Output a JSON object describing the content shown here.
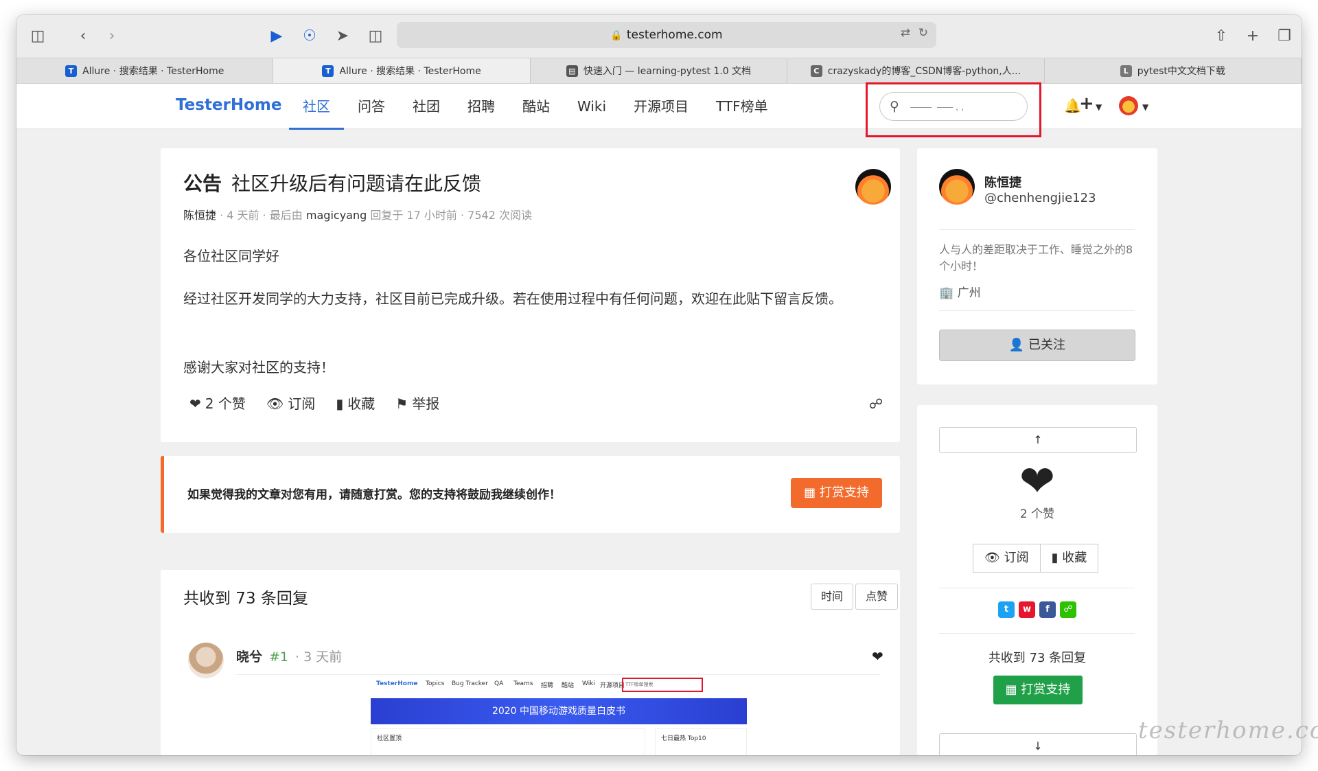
{
  "browser": {
    "url": "testerhome.com",
    "tabs": [
      {
        "title": "Allure · 搜索结果 · TesterHome",
        "icon": "shield-icon"
      },
      {
        "title": "Allure · 搜索结果 · TesterHome",
        "icon": "shield-icon"
      },
      {
        "title": "快速入门 — learning-pytest 1.0 文档",
        "icon": "doc-icon"
      },
      {
        "title": "crazyskady的博客_CSDN博客-python,人...",
        "icon": "c-icon"
      },
      {
        "title": "pytest中文文档下载",
        "icon": "l-icon"
      }
    ]
  },
  "site": {
    "logo": "TesterHome",
    "nav": [
      "社区",
      "问答",
      "社团",
      "招聘",
      "酷站",
      "Wiki",
      "开源项目",
      "TTF榜单"
    ],
    "search_value": "‒‒‒‒  ‒‒‒ , ,"
  },
  "post": {
    "tag": "公告",
    "title": "社区升级后有问题请在此反馈",
    "author": "陈恒捷",
    "time": "· 4 天前 · 最后由",
    "last_replier": "magicyang",
    "reply_info": "回复于 17 小时前 · 7542 次阅读",
    "body": [
      "各位社区同学好",
      "经过社区开发同学的大力支持，社区目前已完成升级。若在使用过程中有任何问题，欢迎在此贴下留言反馈。",
      "感谢大家对社区的支持！"
    ],
    "actions": {
      "likes": "2 个赞",
      "subscribe": "订阅",
      "favorite": "收藏",
      "report": "举报"
    }
  },
  "reward": {
    "text": "如果觉得我的文章对您有用，请随意打赏。您的支持将鼓励我继续创作！",
    "button": "打赏支持"
  },
  "replies": {
    "header": "共收到 73 条回复",
    "sort": [
      "时间",
      "点赞"
    ],
    "first": {
      "name": "晓兮",
      "floor": "#1",
      "time": "· 3 天前"
    },
    "embed": {
      "logo": "TesterHome",
      "nav": [
        "Topics",
        "Bug Tracker",
        "QA",
        "Teams",
        "招聘",
        "酷站",
        "Wiki",
        "开源项目"
      ],
      "search": "TTF榜单搜索",
      "banner": "2020 中国移动游戏质量白皮书",
      "col1": "社区置顶",
      "col2": "七日最热 Top10"
    }
  },
  "sidebar": {
    "name": "陈恒捷",
    "login": "@chenhengjie123",
    "bio": "人与人的差距取决于工作、睡觉之外的8个小时！",
    "location": "广州",
    "follow_button": "已关注",
    "like_count": "2 个赞",
    "subscribe": "订阅",
    "favorite": "收藏",
    "reply_count": "共收到 73 条回复",
    "reward_button": "打赏支持"
  },
  "watermark": "testerhome.com",
  "colors": {
    "brand": "#2f6fd6",
    "highlight": "#e3172b",
    "reward_orange": "#f36b2c",
    "reward_green": "#21a04a"
  }
}
